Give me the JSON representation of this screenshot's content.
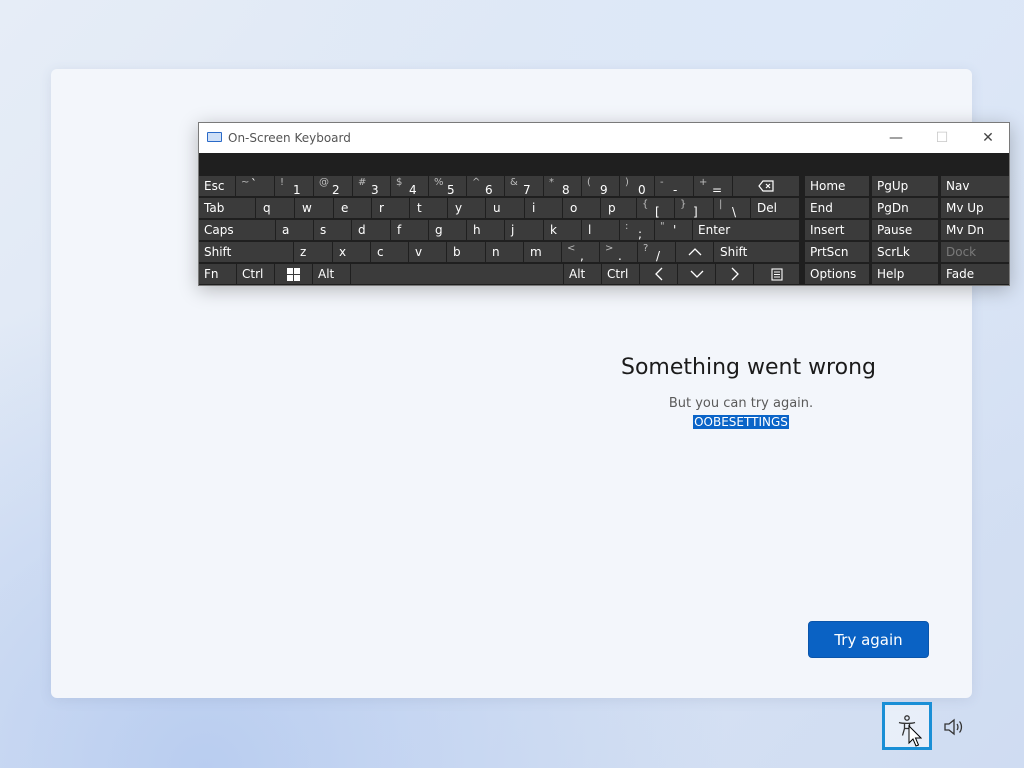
{
  "dialog": {
    "heading": "Something went wrong",
    "subtext": "But you can try again.",
    "code": "OOBESETTINGS",
    "try_again": "Try again"
  },
  "osk": {
    "title": "On-Screen Keyboard",
    "controls": {
      "minimize": "—",
      "maximize": "☐",
      "close": "✕"
    },
    "rows": {
      "esc": "Esc",
      "tab": "Tab",
      "caps": "Caps",
      "shift_left": "Shift",
      "fn": "Fn",
      "ctrl_left": "Ctrl",
      "alt_left": "Alt",
      "enter": "Enter",
      "shift_right": "Shift",
      "alt_right": "Alt",
      "ctrl_right": "Ctrl",
      "del": "Del",
      "letters_q": [
        "q",
        "w",
        "e",
        "r",
        "t",
        "y",
        "u",
        "i",
        "o",
        "p"
      ],
      "letters_a": [
        "a",
        "s",
        "d",
        "f",
        "g",
        "h",
        "j",
        "k",
        "l"
      ],
      "letters_z": [
        "z",
        "x",
        "c",
        "v",
        "b",
        "n",
        "m"
      ],
      "num_shift": [
        "~",
        "!",
        "@",
        "#",
        "$",
        "%",
        "^",
        "&",
        "*",
        "(",
        ")",
        "-",
        "+"
      ],
      "num_main": [
        "`",
        "1",
        "2",
        "3",
        "4",
        "5",
        "6",
        "7",
        "8",
        "9",
        "0",
        "-",
        "="
      ],
      "brackets_shift": [
        "{",
        "}",
        "|"
      ],
      "brackets_main": [
        "[",
        "]",
        "\\"
      ],
      "semi_shift": [
        ":",
        "\""
      ],
      "semi_main": [
        ";",
        "'"
      ],
      "punct_shift": [
        "<",
        ">",
        "?"
      ],
      "punct_main": [
        ",",
        ".",
        "/"
      ]
    },
    "nav": {
      "home": "Home",
      "pgup": "PgUp",
      "nav": "Nav",
      "end": "End",
      "pgdn": "PgDn",
      "mvup": "Mv Up",
      "insert": "Insert",
      "pause": "Pause",
      "mvdn": "Mv Dn",
      "prtscn": "PrtScn",
      "scrlk": "ScrLk",
      "dock": "Dock",
      "options": "Options",
      "help": "Help",
      "fade": "Fade"
    }
  },
  "taskbar": {
    "accessibility_icon": "accessibility-icon",
    "volume_icon": "volume-icon"
  }
}
